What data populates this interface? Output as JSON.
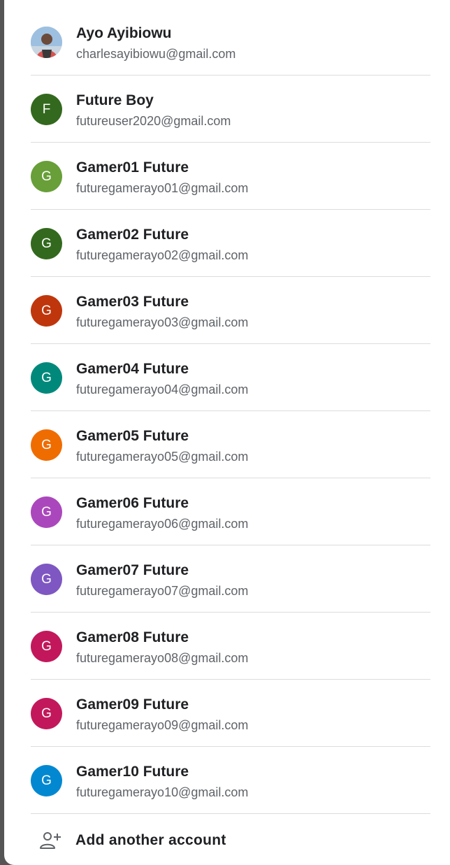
{
  "accounts": [
    {
      "name": "Ayo Ayibiowu",
      "email": "charlesayibiowu@gmail.com",
      "initial": "",
      "color": "#8fb3d6",
      "photo": true
    },
    {
      "name": "Future Boy",
      "email": "futureuser2020@gmail.com",
      "initial": "F",
      "color": "#33691e"
    },
    {
      "name": "Gamer01 Future",
      "email": "futuregamerayo01@gmail.com",
      "initial": "G",
      "color": "#689f38"
    },
    {
      "name": "Gamer02 Future",
      "email": "futuregamerayo02@gmail.com",
      "initial": "G",
      "color": "#33691e"
    },
    {
      "name": "Gamer03 Future",
      "email": "futuregamerayo03@gmail.com",
      "initial": "G",
      "color": "#bf360c"
    },
    {
      "name": "Gamer04 Future",
      "email": "futuregamerayo04@gmail.com",
      "initial": "G",
      "color": "#00897b"
    },
    {
      "name": "Gamer05 Future",
      "email": "futuregamerayo05@gmail.com",
      "initial": "G",
      "color": "#ef6c00"
    },
    {
      "name": "Gamer06 Future",
      "email": "futuregamerayo06@gmail.com",
      "initial": "G",
      "color": "#ab47bc"
    },
    {
      "name": "Gamer07 Future",
      "email": "futuregamerayo07@gmail.com",
      "initial": "G",
      "color": "#7e57c2"
    },
    {
      "name": "Gamer08 Future",
      "email": "futuregamerayo08@gmail.com",
      "initial": "G",
      "color": "#c2185b"
    },
    {
      "name": "Gamer09 Future",
      "email": "futuregamerayo09@gmail.com",
      "initial": "G",
      "color": "#c2185b"
    },
    {
      "name": "Gamer10 Future",
      "email": "futuregamerayo10@gmail.com",
      "initial": "G",
      "color": "#0288d1"
    }
  ],
  "add_account": {
    "label": "Add another account",
    "icon": "person-add-icon"
  }
}
